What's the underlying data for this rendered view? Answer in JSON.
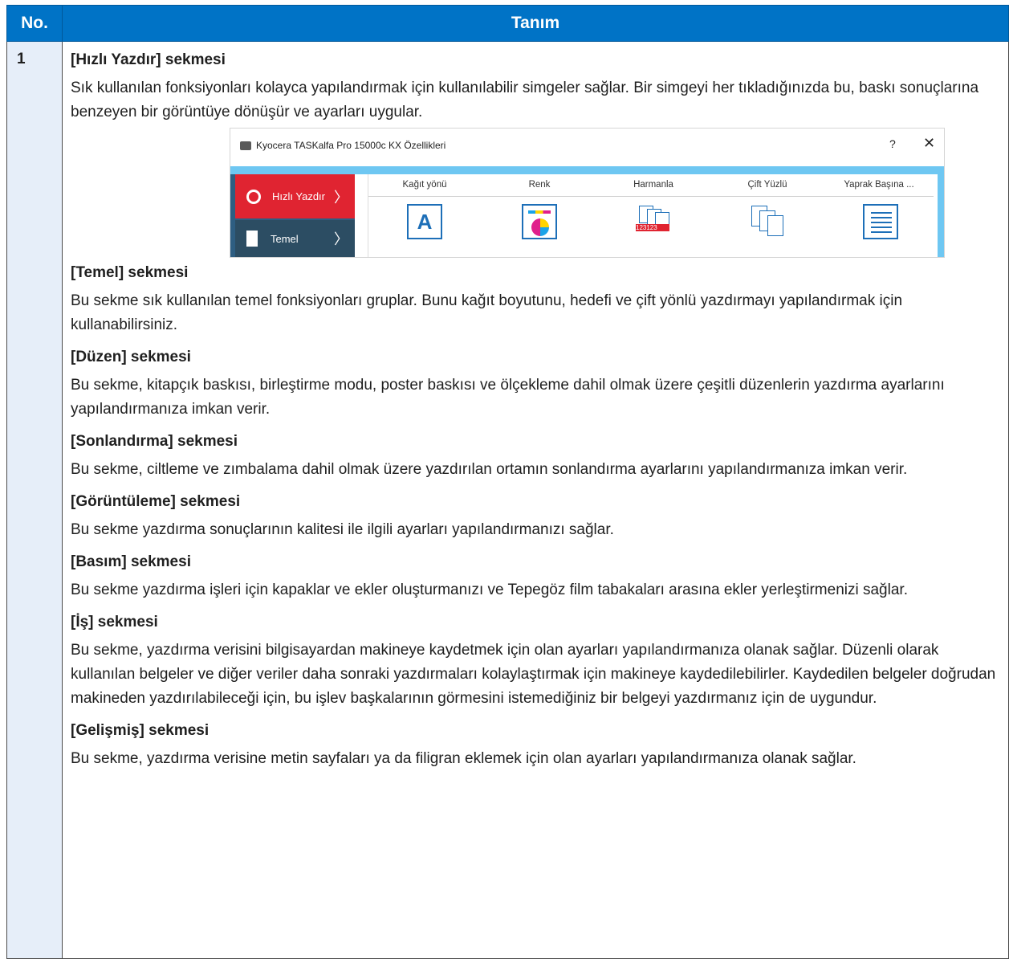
{
  "table": {
    "header_no": "No.",
    "header_desc": "Tanım",
    "row_number": "1"
  },
  "screenshot": {
    "window_title": "Kyocera TASKalfa Pro 15000c KX Özellikleri",
    "help_label": "?",
    "close_label": "✕",
    "tab_quick_print": "Hızlı Yazdır",
    "tab_basic": "Temel",
    "options": [
      "Kağıt yönü",
      "Renk",
      "Harmanla",
      "Çift Yüzlü",
      "Yaprak Başına ..."
    ],
    "collate_band_text": "123123",
    "accent_color": "#e02431",
    "sidebar_color": "#2e5e82"
  },
  "sections": [
    {
      "title": "[Hızlı Yazdır] sekmesi",
      "body": "Sık kullanılan fonksiyonları kolayca yapılandırmak için kullanılabilir simgeler sağlar. Bir simgeyi her tıkladığınızda bu, baskı sonuçlarına benzeyen bir görüntüye dönüşür ve ayarları uygular."
    },
    {
      "title": "[Temel] sekmesi",
      "body": "Bu sekme sık kullanılan temel fonksiyonları gruplar. Bunu kağıt boyutunu, hedefi ve çift yönlü yazdırmayı yapılandırmak için kullanabilirsiniz."
    },
    {
      "title": "[Düzen] sekmesi",
      "body": "Bu sekme, kitapçık baskısı, birleştirme modu, poster baskısı ve ölçekleme dahil olmak üzere çeşitli düzenlerin yazdırma ayarlarını yapılandırmanıza imkan verir."
    },
    {
      "title": "[Sonlandırma] sekmesi",
      "body": "Bu sekme, ciltleme ve zımbalama dahil olmak üzere yazdırılan ortamın sonlandırma ayarlarını yapılandırmanıza imkan verir."
    },
    {
      "title": "[Görüntüleme] sekmesi",
      "body": "Bu sekme yazdırma sonuçlarının kalitesi ile ilgili ayarları yapılandırmanızı sağlar."
    },
    {
      "title": "[Basım] sekmesi",
      "body": "Bu sekme yazdırma işleri için kapaklar ve ekler oluşturmanızı ve Tepegöz film tabakaları arasına ekler yerleştirmenizi sağlar."
    },
    {
      "title": "[İş] sekmesi",
      "body": "Bu sekme, yazdırma verisini bilgisayardan makineye kaydetmek için olan ayarları yapılandırmanıza olanak sağlar. Düzenli olarak kullanılan belgeler ve diğer veriler daha sonraki yazdırmaları kolaylaştırmak için makineye kaydedilebilirler. Kaydedilen belgeler doğrudan makineden yazdırılabileceği için, bu işlev başkalarının görmesini istemediğiniz bir belgeyi yazdırmanız için de uygundur."
    },
    {
      "title": "[Gelişmiş] sekmesi",
      "body": "Bu sekme, yazdırma verisine metin sayfaları ya da filigran eklemek için olan ayarları yapılandırmanıza olanak sağlar."
    }
  ]
}
